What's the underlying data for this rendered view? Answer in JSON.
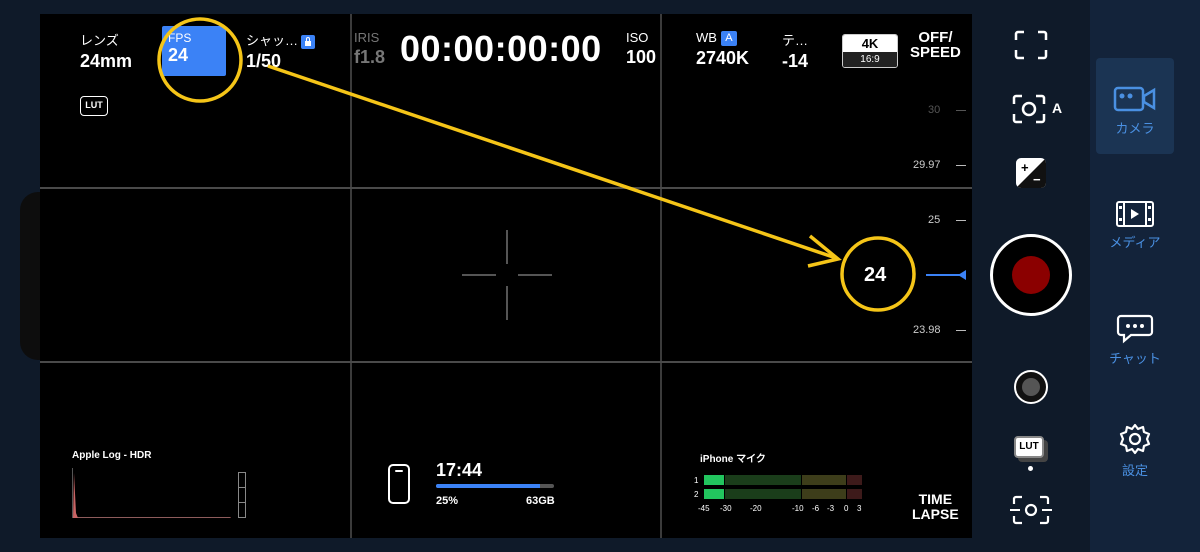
{
  "hud": {
    "lens": {
      "label": "レンズ",
      "value": "24mm"
    },
    "fps": {
      "label": "FPS",
      "value": "24"
    },
    "shutter": {
      "label": "シャッ…",
      "value": "1/50"
    },
    "iris": {
      "label": "IRIS",
      "value": "f1.8"
    },
    "timecode": "00:00:00:00",
    "iso": {
      "label": "ISO",
      "value": "100"
    },
    "wb": {
      "label": "WB",
      "badge": "A",
      "value": "2740K"
    },
    "tint": {
      "label": "テ…",
      "value": "-14"
    },
    "resolution": {
      "top": "4K",
      "bottom": "16:9"
    },
    "speed": {
      "line1": "OFF/",
      "line2": "SPEED"
    },
    "lut_chip": "LUT"
  },
  "fps_scale": {
    "ticks": [
      "30",
      "29.97",
      "25",
      "23.98"
    ],
    "selected": "24"
  },
  "bottom": {
    "histogram_label": "Apple Log - HDR",
    "storage": {
      "time": "17:44",
      "percent": "25%",
      "capacity": "63GB",
      "used_fraction": 0.88
    },
    "audio": {
      "label": "iPhone マイク",
      "ch1": "1",
      "ch2": "2",
      "scale": [
        "-45",
        "-30",
        "-20",
        "-10",
        "-6",
        "-3",
        "0",
        "3"
      ]
    },
    "timelapse": {
      "line1": "TIME",
      "line2": "LAPSE"
    }
  },
  "controls": {
    "lut_button": "LUT",
    "focus_a": "A"
  },
  "sidebar": {
    "items": [
      {
        "label": "カメラ",
        "icon": "camera-icon",
        "active": true
      },
      {
        "label": "メディア",
        "icon": "film-icon",
        "active": false
      },
      {
        "label": "チャット",
        "icon": "chat-icon",
        "active": false
      },
      {
        "label": "設定",
        "icon": "gear-icon",
        "active": false
      }
    ]
  },
  "colors": {
    "accent": "#3b82f6",
    "annotation": "#f5c518",
    "record": "#8b0000",
    "sidebar_text": "#4a90e2"
  }
}
